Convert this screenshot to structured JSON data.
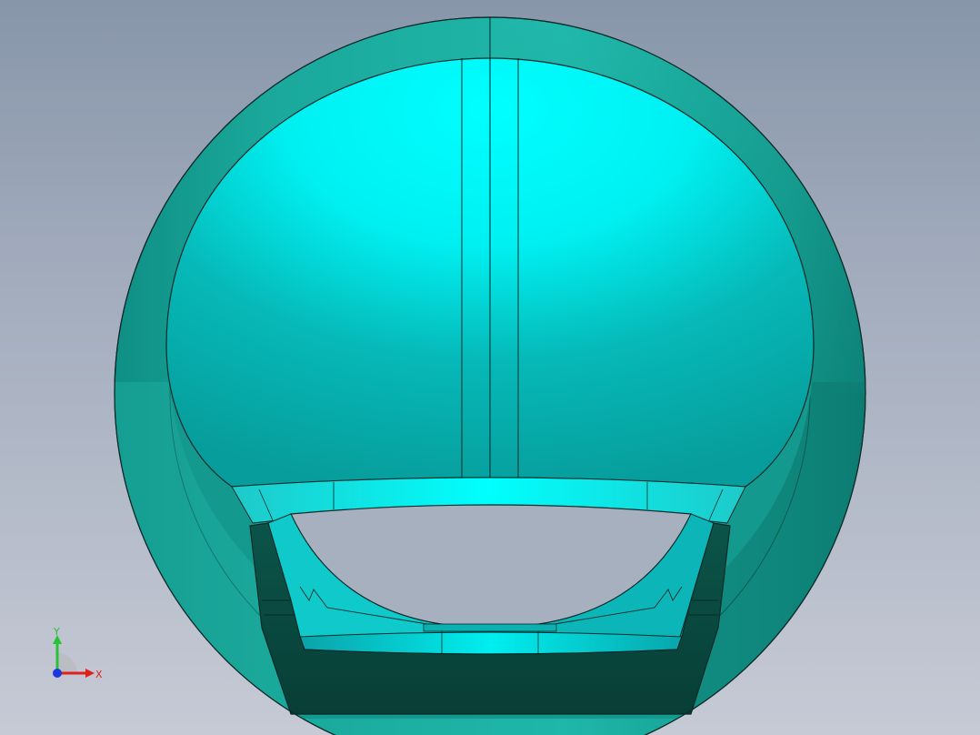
{
  "viewport": {
    "background_top": "#8896aa",
    "background_bottom": "#c6cad5"
  },
  "model": {
    "outer_shell_color": "#1ea79a",
    "inner_surface_color": "#00e2e6",
    "dark_base_color": "#0b4a40",
    "edge_color": "#0a2a28"
  },
  "triad": {
    "x_label": "X",
    "y_label": "Y",
    "x_color": "#e0201a",
    "y_color": "#27c235",
    "z_color": "#1a3ae0"
  }
}
